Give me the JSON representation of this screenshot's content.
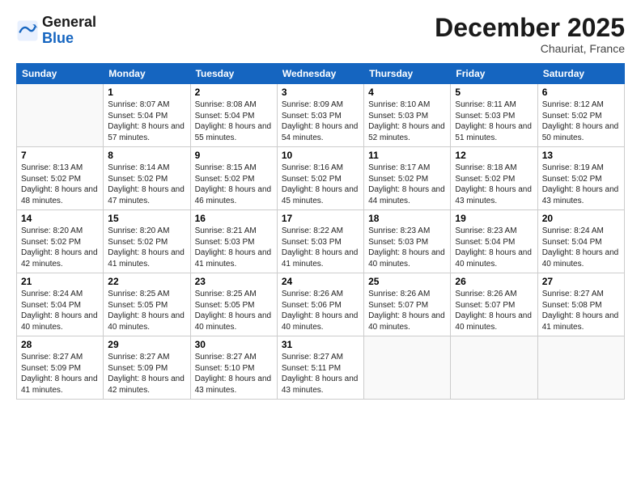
{
  "header": {
    "logo_general": "General",
    "logo_blue": "Blue",
    "month": "December 2025",
    "location": "Chauriat, France"
  },
  "days_of_week": [
    "Sunday",
    "Monday",
    "Tuesday",
    "Wednesday",
    "Thursday",
    "Friday",
    "Saturday"
  ],
  "weeks": [
    [
      {
        "day": "",
        "sunrise": "",
        "sunset": "",
        "daylight": ""
      },
      {
        "day": "1",
        "sunrise": "Sunrise: 8:07 AM",
        "sunset": "Sunset: 5:04 PM",
        "daylight": "Daylight: 8 hours and 57 minutes."
      },
      {
        "day": "2",
        "sunrise": "Sunrise: 8:08 AM",
        "sunset": "Sunset: 5:04 PM",
        "daylight": "Daylight: 8 hours and 55 minutes."
      },
      {
        "day": "3",
        "sunrise": "Sunrise: 8:09 AM",
        "sunset": "Sunset: 5:03 PM",
        "daylight": "Daylight: 8 hours and 54 minutes."
      },
      {
        "day": "4",
        "sunrise": "Sunrise: 8:10 AM",
        "sunset": "Sunset: 5:03 PM",
        "daylight": "Daylight: 8 hours and 52 minutes."
      },
      {
        "day": "5",
        "sunrise": "Sunrise: 8:11 AM",
        "sunset": "Sunset: 5:03 PM",
        "daylight": "Daylight: 8 hours and 51 minutes."
      },
      {
        "day": "6",
        "sunrise": "Sunrise: 8:12 AM",
        "sunset": "Sunset: 5:02 PM",
        "daylight": "Daylight: 8 hours and 50 minutes."
      }
    ],
    [
      {
        "day": "7",
        "sunrise": "Sunrise: 8:13 AM",
        "sunset": "Sunset: 5:02 PM",
        "daylight": "Daylight: 8 hours and 48 minutes."
      },
      {
        "day": "8",
        "sunrise": "Sunrise: 8:14 AM",
        "sunset": "Sunset: 5:02 PM",
        "daylight": "Daylight: 8 hours and 47 minutes."
      },
      {
        "day": "9",
        "sunrise": "Sunrise: 8:15 AM",
        "sunset": "Sunset: 5:02 PM",
        "daylight": "Daylight: 8 hours and 46 minutes."
      },
      {
        "day": "10",
        "sunrise": "Sunrise: 8:16 AM",
        "sunset": "Sunset: 5:02 PM",
        "daylight": "Daylight: 8 hours and 45 minutes."
      },
      {
        "day": "11",
        "sunrise": "Sunrise: 8:17 AM",
        "sunset": "Sunset: 5:02 PM",
        "daylight": "Daylight: 8 hours and 44 minutes."
      },
      {
        "day": "12",
        "sunrise": "Sunrise: 8:18 AM",
        "sunset": "Sunset: 5:02 PM",
        "daylight": "Daylight: 8 hours and 43 minutes."
      },
      {
        "day": "13",
        "sunrise": "Sunrise: 8:19 AM",
        "sunset": "Sunset: 5:02 PM",
        "daylight": "Daylight: 8 hours and 43 minutes."
      }
    ],
    [
      {
        "day": "14",
        "sunrise": "Sunrise: 8:20 AM",
        "sunset": "Sunset: 5:02 PM",
        "daylight": "Daylight: 8 hours and 42 minutes."
      },
      {
        "day": "15",
        "sunrise": "Sunrise: 8:20 AM",
        "sunset": "Sunset: 5:02 PM",
        "daylight": "Daylight: 8 hours and 41 minutes."
      },
      {
        "day": "16",
        "sunrise": "Sunrise: 8:21 AM",
        "sunset": "Sunset: 5:03 PM",
        "daylight": "Daylight: 8 hours and 41 minutes."
      },
      {
        "day": "17",
        "sunrise": "Sunrise: 8:22 AM",
        "sunset": "Sunset: 5:03 PM",
        "daylight": "Daylight: 8 hours and 41 minutes."
      },
      {
        "day": "18",
        "sunrise": "Sunrise: 8:23 AM",
        "sunset": "Sunset: 5:03 PM",
        "daylight": "Daylight: 8 hours and 40 minutes."
      },
      {
        "day": "19",
        "sunrise": "Sunrise: 8:23 AM",
        "sunset": "Sunset: 5:04 PM",
        "daylight": "Daylight: 8 hours and 40 minutes."
      },
      {
        "day": "20",
        "sunrise": "Sunrise: 8:24 AM",
        "sunset": "Sunset: 5:04 PM",
        "daylight": "Daylight: 8 hours and 40 minutes."
      }
    ],
    [
      {
        "day": "21",
        "sunrise": "Sunrise: 8:24 AM",
        "sunset": "Sunset: 5:04 PM",
        "daylight": "Daylight: 8 hours and 40 minutes."
      },
      {
        "day": "22",
        "sunrise": "Sunrise: 8:25 AM",
        "sunset": "Sunset: 5:05 PM",
        "daylight": "Daylight: 8 hours and 40 minutes."
      },
      {
        "day": "23",
        "sunrise": "Sunrise: 8:25 AM",
        "sunset": "Sunset: 5:05 PM",
        "daylight": "Daylight: 8 hours and 40 minutes."
      },
      {
        "day": "24",
        "sunrise": "Sunrise: 8:26 AM",
        "sunset": "Sunset: 5:06 PM",
        "daylight": "Daylight: 8 hours and 40 minutes."
      },
      {
        "day": "25",
        "sunrise": "Sunrise: 8:26 AM",
        "sunset": "Sunset: 5:07 PM",
        "daylight": "Daylight: 8 hours and 40 minutes."
      },
      {
        "day": "26",
        "sunrise": "Sunrise: 8:26 AM",
        "sunset": "Sunset: 5:07 PM",
        "daylight": "Daylight: 8 hours and 40 minutes."
      },
      {
        "day": "27",
        "sunrise": "Sunrise: 8:27 AM",
        "sunset": "Sunset: 5:08 PM",
        "daylight": "Daylight: 8 hours and 41 minutes."
      }
    ],
    [
      {
        "day": "28",
        "sunrise": "Sunrise: 8:27 AM",
        "sunset": "Sunset: 5:09 PM",
        "daylight": "Daylight: 8 hours and 41 minutes."
      },
      {
        "day": "29",
        "sunrise": "Sunrise: 8:27 AM",
        "sunset": "Sunset: 5:09 PM",
        "daylight": "Daylight: 8 hours and 42 minutes."
      },
      {
        "day": "30",
        "sunrise": "Sunrise: 8:27 AM",
        "sunset": "Sunset: 5:10 PM",
        "daylight": "Daylight: 8 hours and 43 minutes."
      },
      {
        "day": "31",
        "sunrise": "Sunrise: 8:27 AM",
        "sunset": "Sunset: 5:11 PM",
        "daylight": "Daylight: 8 hours and 43 minutes."
      },
      {
        "day": "",
        "sunrise": "",
        "sunset": "",
        "daylight": ""
      },
      {
        "day": "",
        "sunrise": "",
        "sunset": "",
        "daylight": ""
      },
      {
        "day": "",
        "sunrise": "",
        "sunset": "",
        "daylight": ""
      }
    ]
  ]
}
